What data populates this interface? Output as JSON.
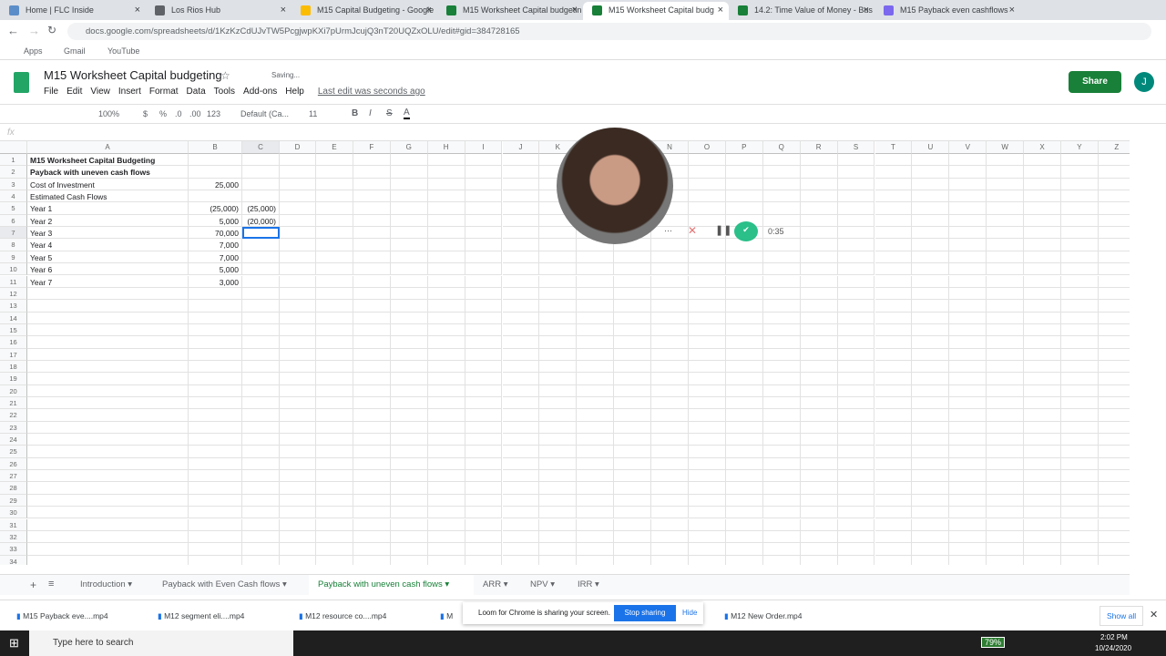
{
  "browser": {
    "tabs": [
      {
        "label": "Home | FLC Inside",
        "color": "#5b8ec9"
      },
      {
        "label": "Los Rios Hub",
        "color": "#5f6368"
      },
      {
        "label": "M15 Capital Budgeting - Google",
        "color": "#fbbc04"
      },
      {
        "label": "M15 Worksheet Capital budgetin",
        "color": "#188038"
      },
      {
        "label": "M15 Worksheet Capital budg",
        "color": "#188038",
        "active": true
      },
      {
        "label": "14.2: Time Value of Money - Bus",
        "color": "#188038"
      },
      {
        "label": "M15 Payback even cashflows",
        "color": "#7b68ee"
      }
    ],
    "url": "docs.google.com/spreadsheets/d/1KzKzCdUJvTW5PcgjwpKXi7pUrmJcujQ3nT20UQZxOLU/edit#gid=384728165",
    "bookmarks": [
      "Apps",
      "Gmail",
      "YouTube"
    ]
  },
  "doc": {
    "title": "M15 Worksheet Capital budgeting",
    "status": "Saving...",
    "share": "Share",
    "avatar": "J",
    "menu": [
      "File",
      "Edit",
      "View",
      "Insert",
      "Format",
      "Data",
      "Tools",
      "Add-ons",
      "Help"
    ],
    "last_edit": "Last edit was seconds ago"
  },
  "toolbar": {
    "zoom": "100%",
    "currency": "$",
    "percent": "%",
    "dec_less": ".0",
    "dec_more": ".00",
    "format": "123",
    "font": "Default (Ca...",
    "size": "11",
    "bold": "B",
    "italic": "I",
    "strike": "S",
    "textcolor": "A"
  },
  "formula_bar": {
    "label": "fx"
  },
  "columns": [
    "A",
    "B",
    "C",
    "D",
    "E",
    "F",
    "G",
    "H",
    "I",
    "J",
    "K",
    "L",
    "M",
    "N",
    "O",
    "P",
    "Q",
    "R",
    "S",
    "T",
    "U",
    "V",
    "W",
    "X",
    "Y",
    "Z"
  ],
  "rows": [
    {
      "A": "M15 Worksheet Capital Budgeting",
      "bold": true
    },
    {
      "A": "Payback with uneven cash flows",
      "bold": true
    },
    {
      "A": "Cost of Investment",
      "B": "25,000"
    },
    {
      "A": "Estimated Cash Flows"
    },
    {
      "A": "Year 1",
      "B": "(25,000)",
      "C": "(25,000)"
    },
    {
      "A": "Year 2",
      "B": "5,000",
      "C": "(20,000)"
    },
    {
      "A": "Year 3",
      "B": "70,000"
    },
    {
      "A": "Year 4",
      "B": "7,000"
    },
    {
      "A": "Year 5",
      "B": "7,000"
    },
    {
      "A": "Year 6",
      "B": "5,000"
    },
    {
      "A": "Year 7",
      "B": "3,000"
    }
  ],
  "selected_cell": "C7",
  "sheets": [
    {
      "label": "Introduction"
    },
    {
      "label": "Payback with Even Cash flows"
    },
    {
      "label": "Payback with uneven cash flows",
      "active": true
    },
    {
      "label": "ARR"
    },
    {
      "label": "NPV"
    },
    {
      "label": "IRR"
    }
  ],
  "recorder": {
    "time": "0:35"
  },
  "downloads": [
    "M15 Payback eve....mp4",
    "M12 segment eli....mp4",
    "M12 resource co....mp4",
    "M",
    "M12 New Order.mp4"
  ],
  "downloads_show_all": "Show all",
  "loom": {
    "message": "Loom for Chrome is sharing your screen.",
    "stop": "Stop sharing",
    "hide": "Hide"
  },
  "taskbar": {
    "search": "Type here to search",
    "battery": "79%",
    "time": "2:02 PM",
    "date": "10/24/2020"
  }
}
